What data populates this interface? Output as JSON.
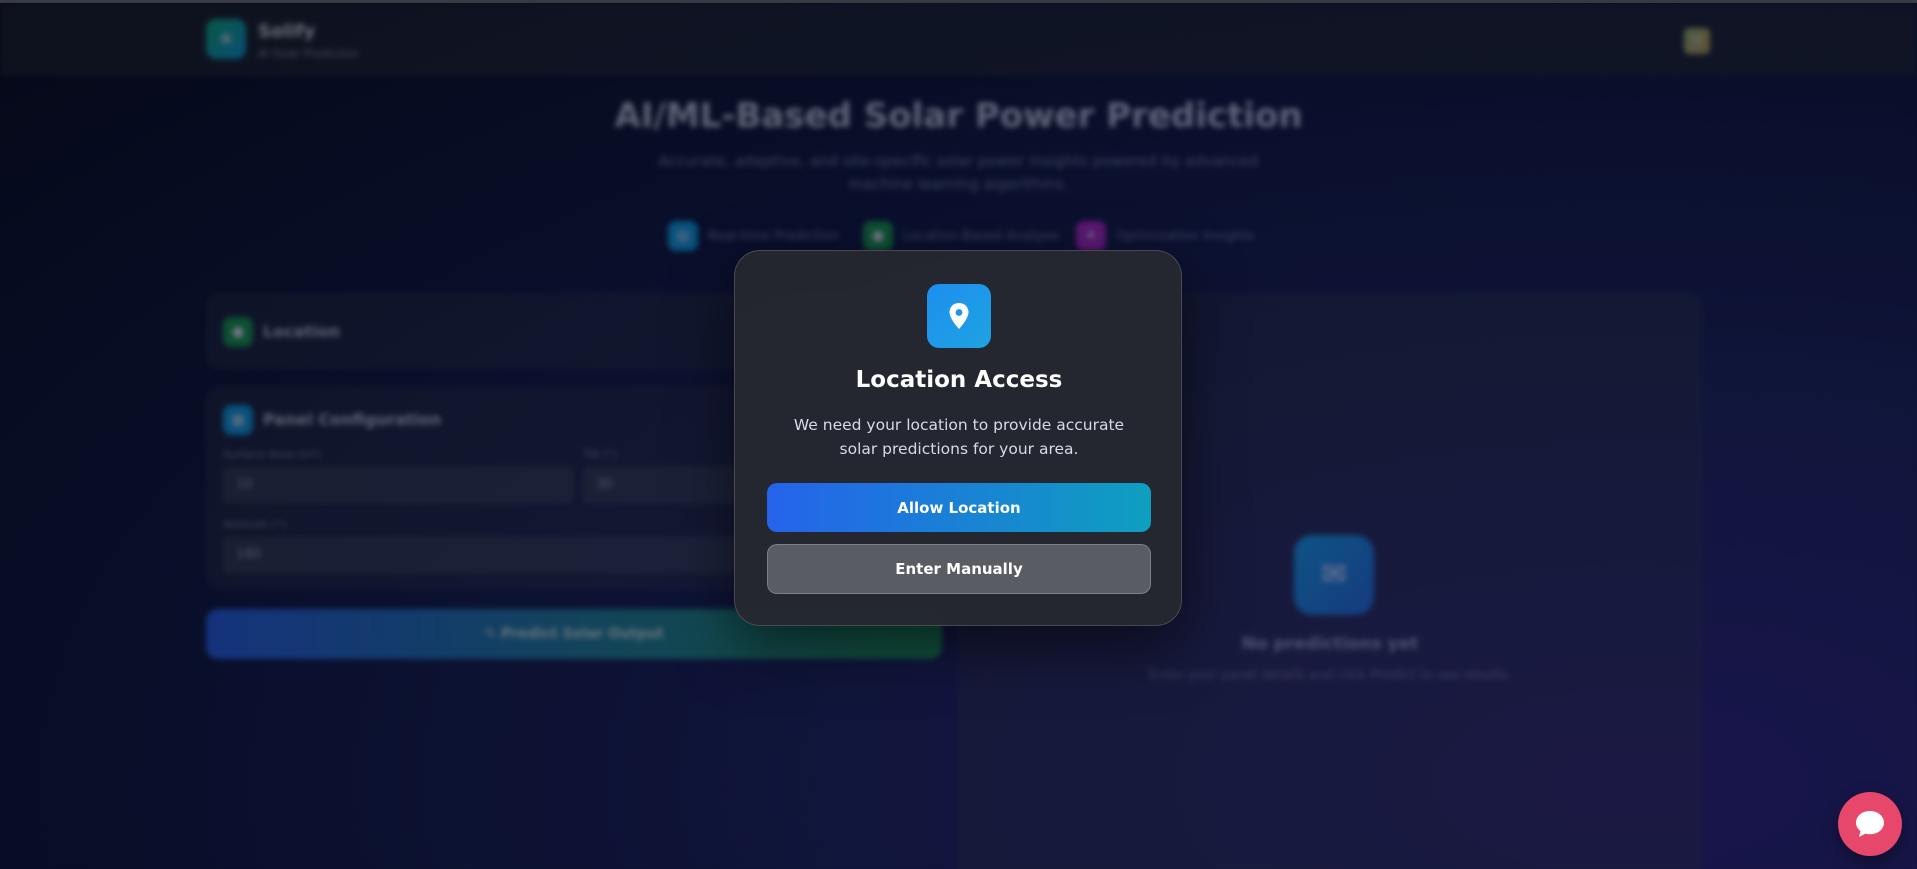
{
  "navbar": {
    "brand_name": "Solify",
    "brand_sub": "AI Solar Prediction",
    "logo_icon": "sun-icon",
    "theme_toggle_icon": "theme-toggle-icon"
  },
  "hero": {
    "title": "AI/ML-Based Solar Power Prediction",
    "subtitle": "Accurate, adaptive, and site-specific solar power insights powered by advanced machine learning algorithms."
  },
  "features": [
    {
      "label": "Real-time Prediction",
      "icon": "chart-icon",
      "color": "#0ea5e9"
    },
    {
      "label": "Location-Based Analysis",
      "icon": "pin-icon",
      "color": "#16a34a"
    },
    {
      "label": "Optimization Insights",
      "icon": "bulb-icon",
      "color": "#c026d3"
    }
  ],
  "location_card": {
    "title": "Location",
    "icon": "pin-icon"
  },
  "panel_card": {
    "title": "Panel Configuration",
    "icon": "panel-icon",
    "fields": {
      "surface_area_label": "Surface Area (m²)",
      "surface_area_value": "10",
      "tilt_label": "Tilt (°)",
      "tilt_value": "30",
      "azimuth_label": "Azimuth (°)",
      "azimuth_value": "180"
    }
  },
  "predict_button": {
    "label": "Predict Solar Output",
    "icon": "pencil-icon"
  },
  "results": {
    "empty_icon": "chat-icon",
    "empty_title": "No predictions yet",
    "empty_sub": "Enter your panel details and click Predict to see results."
  },
  "modal": {
    "icon": "location-pin-icon",
    "title": "Location Access",
    "description": "We need your location to provide accurate solar predictions for your area.",
    "allow_label": "Allow Location",
    "manual_label": "Enter Manually"
  },
  "chat_fab": {
    "icon": "chat-bubble-icon",
    "color": "#e6476a"
  },
  "colors": {
    "accent_blue": "#2563eb",
    "accent_cyan": "#0e9fbf",
    "modal_bg": "#252830"
  }
}
